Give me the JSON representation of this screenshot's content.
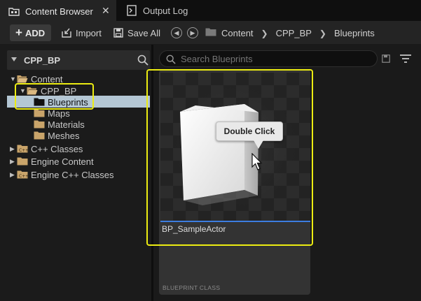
{
  "tabs": {
    "active": {
      "label": "Content Browser",
      "icon": "folder-grid-icon"
    },
    "inactive": {
      "label": "Output Log",
      "icon": "output-log-icon"
    }
  },
  "toolbar": {
    "add_label": "ADD",
    "import_label": "Import",
    "save_all_label": "Save All"
  },
  "breadcrumbs": [
    "Content",
    "CPP_BP",
    "Blueprints"
  ],
  "left_panel": {
    "title": "CPP_BP",
    "tree": [
      {
        "label": "Content",
        "level": 0,
        "expanded": true
      },
      {
        "label": "CPP_BP",
        "level": 1,
        "expanded": true
      },
      {
        "label": "Blueprints",
        "level": 2,
        "selected": true
      },
      {
        "label": "Maps",
        "level": 2
      },
      {
        "label": "Materials",
        "level": 2
      },
      {
        "label": "Meshes",
        "level": 2
      },
      {
        "label": "C++ Classes",
        "level": 0
      },
      {
        "label": "Engine Content",
        "level": 0
      },
      {
        "label": "Engine C++ Classes",
        "level": 0
      }
    ]
  },
  "content": {
    "search_placeholder": "Search Blueprints",
    "asset": {
      "name": "BP_SampleActor",
      "class_label": "BLUEPRINT CLASS"
    },
    "tooltip": "Double Click"
  },
  "colors": {
    "highlight": "#ecec12",
    "selection": "#b4c7d4",
    "accent_line": "#3c7de0",
    "folder": "#c9a46a"
  }
}
